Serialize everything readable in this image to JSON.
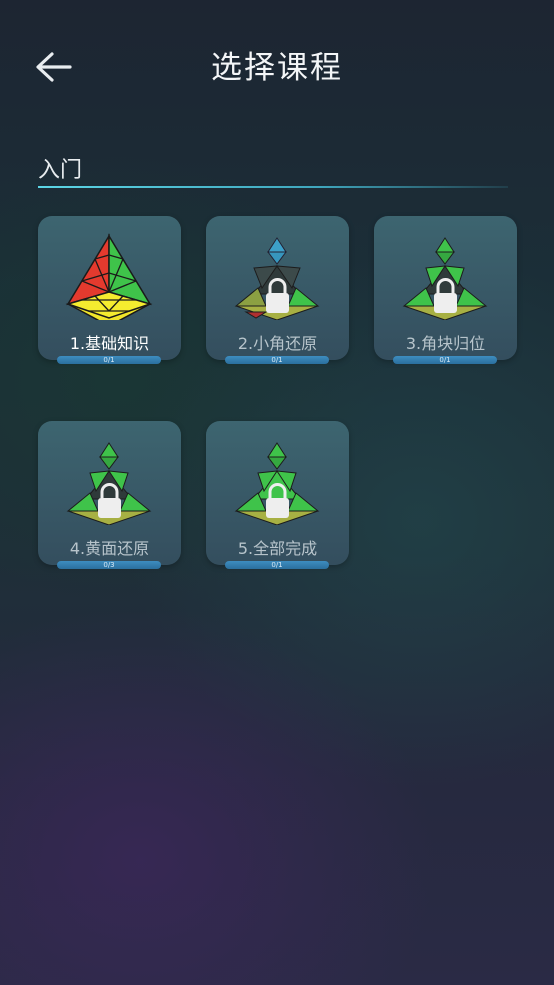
{
  "header": {
    "title": "选择课程",
    "back_icon": "arrow-left-icon"
  },
  "section": {
    "label": "入门"
  },
  "courses": [
    {
      "label": "1.基础知识",
      "progress_text": "0/1",
      "progress": 0,
      "locked": false
    },
    {
      "label": "2.小角还原",
      "progress_text": "0/1",
      "progress": 0,
      "locked": true
    },
    {
      "label": "3.角块归位",
      "progress_text": "0/1",
      "progress": 0,
      "locked": true
    },
    {
      "label": "4.黄面还原",
      "progress_text": "0/3",
      "progress": 0,
      "locked": true
    },
    {
      "label": "5.全部完成",
      "progress_text": "0/1",
      "progress": 0,
      "locked": true
    }
  ],
  "colors": {
    "accent_line": "#5cd6e6",
    "progress_bar": "#2b6f9e",
    "card": "#385866"
  }
}
